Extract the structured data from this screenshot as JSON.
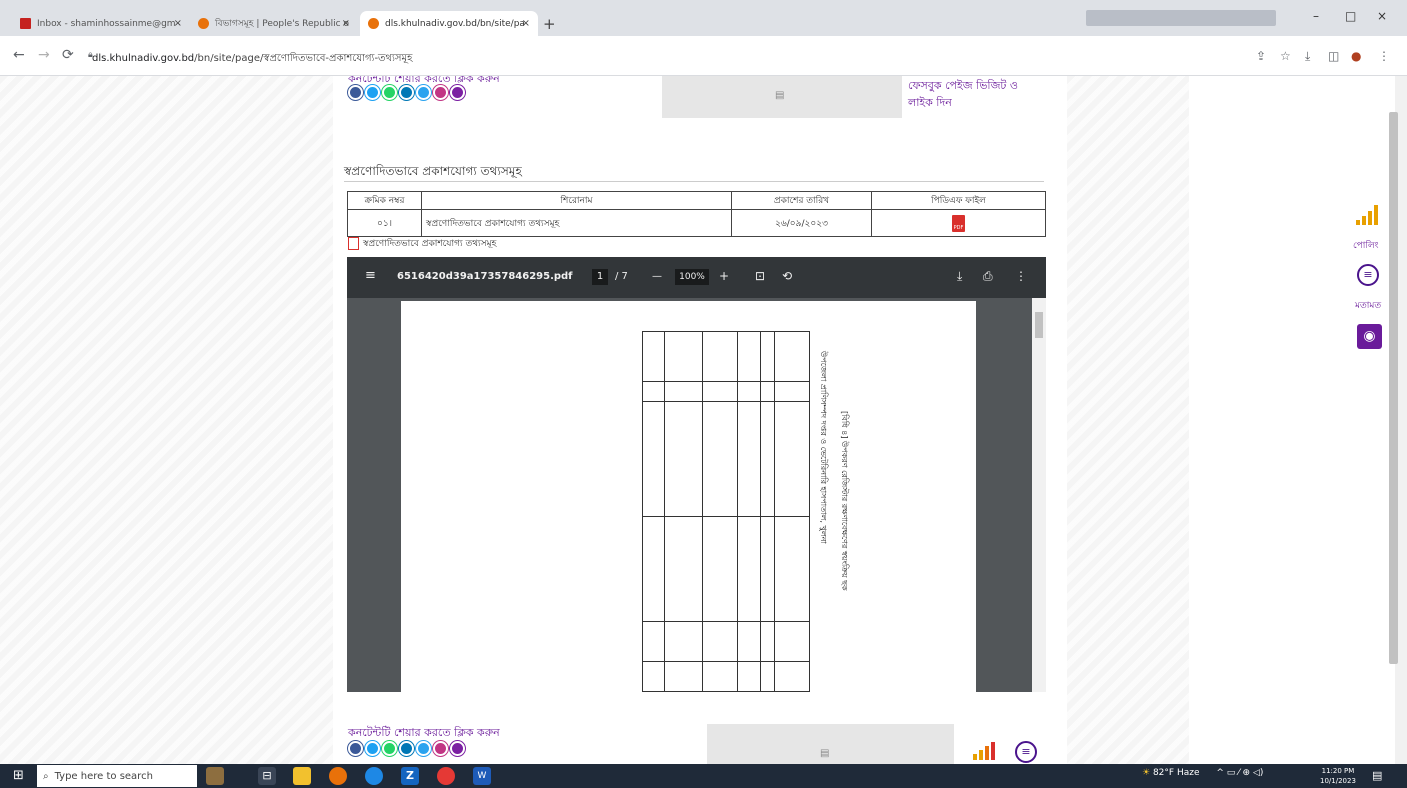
{
  "browser": {
    "tabs": [
      {
        "label": "Inbox - shaminhossainme@gm",
        "favicon_color": "#c5221f"
      },
      {
        "label": "বিভাগসমূহ | People's Republic o",
        "favicon_color": "#e8710a"
      },
      {
        "label": "dls.khulnadiv.gov.bd/bn/site/pa",
        "favicon_color": "#e8710a"
      }
    ],
    "new_tab": "+",
    "window_controls": [
      "–",
      "□",
      "×"
    ],
    "url_host": "dls.khulnadiv.gov.bd",
    "url_path": "/bn/site/page/স্বপ্রণোদিতভাবে-প্রকাশযোগ্য-তথ্যসমূহ"
  },
  "top_share": {
    "label": "কনটেন্টটি শেয়ার করতে ক্লিক করুন"
  },
  "facebook_box": {
    "text": "ফেসবুক পেইজ ভিজিট ও লাইক দিন"
  },
  "section": {
    "title": "স্বপ্রণোদিতভাবে প্রকাশযোগ্য তথ্যসমূহ"
  },
  "table": {
    "headers": [
      "ক্রমিক নম্বর",
      "শিরোনাম",
      "প্রকাশের তারিখ",
      "পিডিএফ ফাইল"
    ],
    "rows": [
      {
        "serial": "০১।",
        "title": "স্বপ্রণোদিতভাবে প্রকাশযোগ্য তথ্যসমূহ",
        "date": "২৬/০৯/২০২৩",
        "file": "PDF"
      }
    ]
  },
  "pdf_link": {
    "label": "স্বপ্রণোদিতভাবে প্রকাশযোগ্য তথ্যসমূহ"
  },
  "viewer": {
    "filename": "6516420d39a17357846295.pdf",
    "page": "1",
    "page_total": "/ 7",
    "zoom": "100%",
    "menu_icon": "≡",
    "minus": "—",
    "plus": "+"
  },
  "rotated_doc": {
    "heading": "[বিধি ৪] উপকরণ রেজিস্টার রক্ষণাবেক্ষণের স্বয়ংক্রিয় ছক",
    "subheading": "উপজেলা প্রাণিসম্পদ দপ্তর ও ভেটেরিনারি হাসপাতাল, খুলনা"
  },
  "bottom_share": {
    "label": "কনটেন্টটি শেয়ার করতে ক্লিক করুন"
  },
  "side": {
    "poll_label": "পোলিং",
    "feedback_label": "মতামত"
  },
  "taskbar": {
    "search_placeholder": "Type here to search",
    "weather": "82°F  Haze",
    "time": "11:20 PM",
    "date": "10/1/2023"
  },
  "colors": {
    "accent": "#6a1b9a",
    "social": [
      "#3b5998",
      "#1da1f2",
      "#25d366",
      "#0077b5",
      "#2aa3ef",
      "#c13584",
      "#7b1fa2"
    ]
  }
}
